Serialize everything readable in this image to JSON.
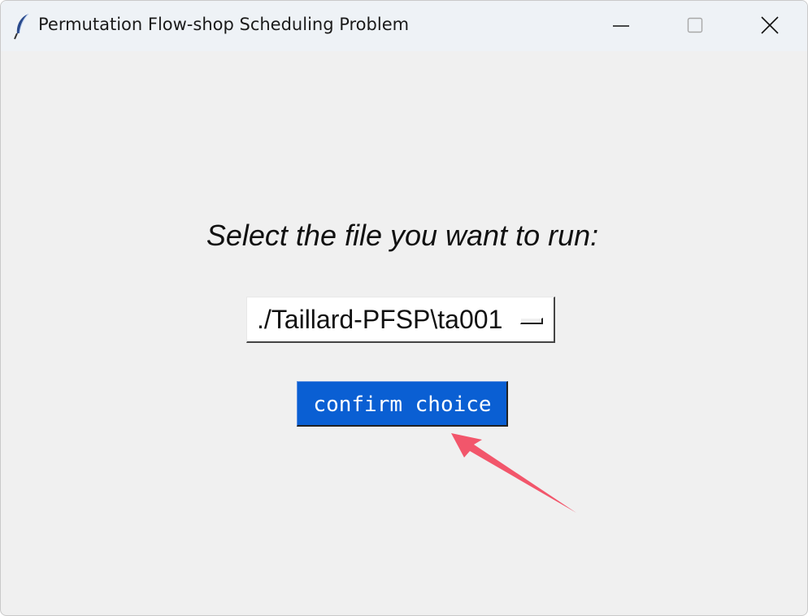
{
  "window": {
    "title": "Permutation Flow-shop Scheduling Problem",
    "app_icon": "feather-icon",
    "controls": [
      "minimize-icon",
      "maximize-icon",
      "close-icon"
    ]
  },
  "main": {
    "prompt": "Select the file you want to run:",
    "file_select": {
      "selected_value": "./Taillard-PFSP\\ta001"
    },
    "confirm_button_label": "confirm choice"
  },
  "colors": {
    "window_background": "#f0f0f0",
    "titlebar_background": "#eef2f6",
    "button_background": "#0a5fd3",
    "button_text": "#ffffff",
    "annotation_arrow": "#f2566b"
  }
}
